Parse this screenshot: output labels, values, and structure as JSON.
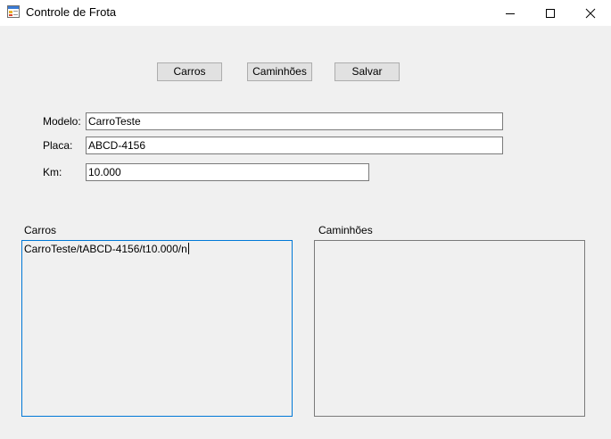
{
  "window": {
    "title": "Controle de Frota",
    "app_icon": "form-icon",
    "controls": {
      "minimize_icon": "minimize-icon",
      "maximize_icon": "maximize-icon",
      "close_icon": "close-icon"
    }
  },
  "toolbar": {
    "carros_label": "Carros",
    "caminhoes_label": "Caminhões",
    "salvar_label": "Salvar"
  },
  "form": {
    "modelo_label": "Modelo:",
    "modelo_value": "CarroTeste",
    "placa_label": "Placa:",
    "placa_value": "ABCD-4156",
    "km_label": "Km:",
    "km_value": "10.000"
  },
  "lists": {
    "carros_label": "Carros",
    "carros_text": "CarroTeste/tABCD-4156/t10.000/n",
    "caminhoes_label": "Caminhões",
    "caminhoes_text": ""
  },
  "colors": {
    "window_bg": "#f0f0f0",
    "focus_border": "#0078d7"
  }
}
